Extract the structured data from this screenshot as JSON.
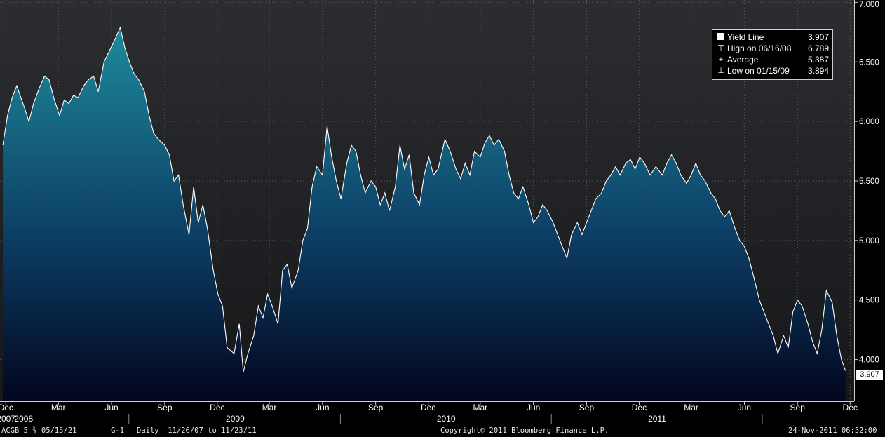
{
  "chart_data": {
    "type": "area",
    "series": [
      {
        "name": "Yield Line",
        "points": [
          [
            "2007-11-26",
            5.8
          ],
          [
            "2007-12-04",
            6.05
          ],
          [
            "2007-12-12",
            6.2
          ],
          [
            "2007-12-20",
            6.3
          ],
          [
            "2008-01-02",
            6.12
          ],
          [
            "2008-01-10",
            6.0
          ],
          [
            "2008-01-18",
            6.15
          ],
          [
            "2008-01-28",
            6.28
          ],
          [
            "2008-02-06",
            6.38
          ],
          [
            "2008-02-14",
            6.35
          ],
          [
            "2008-02-22",
            6.2
          ],
          [
            "2008-03-03",
            6.05
          ],
          [
            "2008-03-11",
            6.18
          ],
          [
            "2008-03-19",
            6.15
          ],
          [
            "2008-03-27",
            6.22
          ],
          [
            "2008-04-04",
            6.2
          ],
          [
            "2008-04-14",
            6.3
          ],
          [
            "2008-04-22",
            6.35
          ],
          [
            "2008-05-01",
            6.38
          ],
          [
            "2008-05-09",
            6.25
          ],
          [
            "2008-05-19",
            6.5
          ],
          [
            "2008-05-29",
            6.6
          ],
          [
            "2008-06-06",
            6.68
          ],
          [
            "2008-06-16",
            6.789
          ],
          [
            "2008-06-24",
            6.62
          ],
          [
            "2008-07-02",
            6.5
          ],
          [
            "2008-07-10",
            6.4
          ],
          [
            "2008-07-18",
            6.35
          ],
          [
            "2008-07-28",
            6.25
          ],
          [
            "2008-08-05",
            6.05
          ],
          [
            "2008-08-13",
            5.9
          ],
          [
            "2008-08-21",
            5.85
          ],
          [
            "2008-09-01",
            5.8
          ],
          [
            "2008-09-09",
            5.72
          ],
          [
            "2008-09-17",
            5.5
          ],
          [
            "2008-09-25",
            5.55
          ],
          [
            "2008-10-03",
            5.3
          ],
          [
            "2008-10-13",
            5.05
          ],
          [
            "2008-10-21",
            5.45
          ],
          [
            "2008-10-29",
            5.15
          ],
          [
            "2008-11-06",
            5.3
          ],
          [
            "2008-11-14",
            5.1
          ],
          [
            "2008-11-24",
            4.75
          ],
          [
            "2008-12-02",
            4.55
          ],
          [
            "2008-12-10",
            4.45
          ],
          [
            "2008-12-18",
            4.1
          ],
          [
            "2008-12-30",
            4.05
          ],
          [
            "2009-01-08",
            4.3
          ],
          [
            "2009-01-15",
            3.894
          ],
          [
            "2009-01-23",
            4.05
          ],
          [
            "2009-02-02",
            4.2
          ],
          [
            "2009-02-10",
            4.45
          ],
          [
            "2009-02-18",
            4.35
          ],
          [
            "2009-02-26",
            4.55
          ],
          [
            "2009-03-06",
            4.45
          ],
          [
            "2009-03-16",
            4.3
          ],
          [
            "2009-03-24",
            4.75
          ],
          [
            "2009-04-01",
            4.8
          ],
          [
            "2009-04-09",
            4.6
          ],
          [
            "2009-04-20",
            4.75
          ],
          [
            "2009-04-28",
            5.0
          ],
          [
            "2009-05-06",
            5.1
          ],
          [
            "2009-05-14",
            5.45
          ],
          [
            "2009-05-22",
            5.62
          ],
          [
            "2009-06-01",
            5.55
          ],
          [
            "2009-06-09",
            5.96
          ],
          [
            "2009-06-17",
            5.7
          ],
          [
            "2009-06-25",
            5.5
          ],
          [
            "2009-07-03",
            5.35
          ],
          [
            "2009-07-13",
            5.65
          ],
          [
            "2009-07-21",
            5.8
          ],
          [
            "2009-07-29",
            5.75
          ],
          [
            "2009-08-06",
            5.55
          ],
          [
            "2009-08-14",
            5.4
          ],
          [
            "2009-08-24",
            5.5
          ],
          [
            "2009-09-01",
            5.45
          ],
          [
            "2009-09-09",
            5.3
          ],
          [
            "2009-09-17",
            5.4
          ],
          [
            "2009-09-25",
            5.25
          ],
          [
            "2009-10-05",
            5.45
          ],
          [
            "2009-10-13",
            5.8
          ],
          [
            "2009-10-21",
            5.6
          ],
          [
            "2009-10-29",
            5.72
          ],
          [
            "2009-11-06",
            5.4
          ],
          [
            "2009-11-16",
            5.3
          ],
          [
            "2009-11-24",
            5.55
          ],
          [
            "2009-12-02",
            5.7
          ],
          [
            "2009-12-10",
            5.55
          ],
          [
            "2009-12-18",
            5.6
          ],
          [
            "2009-12-30",
            5.85
          ],
          [
            "2010-01-08",
            5.75
          ],
          [
            "2010-01-18",
            5.6
          ],
          [
            "2010-01-26",
            5.52
          ],
          [
            "2010-02-03",
            5.65
          ],
          [
            "2010-02-11",
            5.55
          ],
          [
            "2010-02-19",
            5.75
          ],
          [
            "2010-03-01",
            5.7
          ],
          [
            "2010-03-09",
            5.82
          ],
          [
            "2010-03-17",
            5.88
          ],
          [
            "2010-03-25",
            5.8
          ],
          [
            "2010-04-02",
            5.85
          ],
          [
            "2010-04-12",
            5.75
          ],
          [
            "2010-04-20",
            5.55
          ],
          [
            "2010-04-28",
            5.4
          ],
          [
            "2010-05-06",
            5.35
          ],
          [
            "2010-05-14",
            5.45
          ],
          [
            "2010-05-24",
            5.3
          ],
          [
            "2010-06-01",
            5.15
          ],
          [
            "2010-06-09",
            5.2
          ],
          [
            "2010-06-17",
            5.3
          ],
          [
            "2010-06-25",
            5.25
          ],
          [
            "2010-07-05",
            5.15
          ],
          [
            "2010-07-13",
            5.05
          ],
          [
            "2010-07-21",
            4.95
          ],
          [
            "2010-07-29",
            4.85
          ],
          [
            "2010-08-06",
            5.05
          ],
          [
            "2010-08-16",
            5.15
          ],
          [
            "2010-08-24",
            5.05
          ],
          [
            "2010-09-01",
            5.15
          ],
          [
            "2010-09-09",
            5.25
          ],
          [
            "2010-09-17",
            5.35
          ],
          [
            "2010-09-27",
            5.4
          ],
          [
            "2010-10-05",
            5.5
          ],
          [
            "2010-10-13",
            5.55
          ],
          [
            "2010-10-21",
            5.62
          ],
          [
            "2010-10-29",
            5.55
          ],
          [
            "2010-11-08",
            5.65
          ],
          [
            "2010-11-16",
            5.68
          ],
          [
            "2010-11-24",
            5.6
          ],
          [
            "2010-12-02",
            5.7
          ],
          [
            "2010-12-10",
            5.65
          ],
          [
            "2010-12-20",
            5.55
          ],
          [
            "2010-12-30",
            5.62
          ],
          [
            "2011-01-10",
            5.55
          ],
          [
            "2011-01-18",
            5.65
          ],
          [
            "2011-01-26",
            5.72
          ],
          [
            "2011-02-03",
            5.65
          ],
          [
            "2011-02-11",
            5.55
          ],
          [
            "2011-02-21",
            5.48
          ],
          [
            "2011-03-01",
            5.55
          ],
          [
            "2011-03-09",
            5.65
          ],
          [
            "2011-03-17",
            5.55
          ],
          [
            "2011-03-25",
            5.5
          ],
          [
            "2011-04-04",
            5.4
          ],
          [
            "2011-04-12",
            5.35
          ],
          [
            "2011-04-20",
            5.25
          ],
          [
            "2011-04-28",
            5.2
          ],
          [
            "2011-05-06",
            5.25
          ],
          [
            "2011-05-16",
            5.1
          ],
          [
            "2011-05-24",
            5.0
          ],
          [
            "2011-06-01",
            4.95
          ],
          [
            "2011-06-09",
            4.85
          ],
          [
            "2011-06-17",
            4.7
          ],
          [
            "2011-06-27",
            4.5
          ],
          [
            "2011-07-05",
            4.4
          ],
          [
            "2011-07-13",
            4.3
          ],
          [
            "2011-07-21",
            4.2
          ],
          [
            "2011-07-29",
            4.05
          ],
          [
            "2011-08-08",
            4.2
          ],
          [
            "2011-08-16",
            4.1
          ],
          [
            "2011-08-24",
            4.4
          ],
          [
            "2011-09-01",
            4.5
          ],
          [
            "2011-09-09",
            4.45
          ],
          [
            "2011-09-19",
            4.3
          ],
          [
            "2011-09-27",
            4.15
          ],
          [
            "2011-10-05",
            4.05
          ],
          [
            "2011-10-13",
            4.25
          ],
          [
            "2011-10-21",
            4.58
          ],
          [
            "2011-10-31",
            4.48
          ],
          [
            "2011-11-08",
            4.2
          ],
          [
            "2011-11-16",
            4.0
          ],
          [
            "2011-11-23",
            3.907
          ]
        ]
      }
    ],
    "y_ticks": [
      "4.000",
      "4.500",
      "5.000",
      "5.500",
      "6.000",
      "6.500",
      "7.000"
    ],
    "ylim": [
      3.65,
      7.02
    ],
    "x_range": [
      "2007-11-21",
      "2011-12-08"
    ],
    "x_month_ticks": [
      {
        "date": "2007-12-01",
        "label": "Dec"
      },
      {
        "date": "2008-03-01",
        "label": "Mar"
      },
      {
        "date": "2008-06-01",
        "label": "Jun"
      },
      {
        "date": "2008-09-01",
        "label": "Sep"
      },
      {
        "date": "2008-12-01",
        "label": "Dec"
      },
      {
        "date": "2009-03-01",
        "label": "Mar"
      },
      {
        "date": "2009-06-01",
        "label": "Jun"
      },
      {
        "date": "2009-09-01",
        "label": "Sep"
      },
      {
        "date": "2009-12-01",
        "label": "Dec"
      },
      {
        "date": "2010-03-01",
        "label": "Mar"
      },
      {
        "date": "2010-06-01",
        "label": "Jun"
      },
      {
        "date": "2010-09-01",
        "label": "Sep"
      },
      {
        "date": "2010-12-01",
        "label": "Dec"
      },
      {
        "date": "2011-03-01",
        "label": "Mar"
      },
      {
        "date": "2011-06-01",
        "label": "Jun"
      },
      {
        "date": "2011-09-01",
        "label": "Sep"
      },
      {
        "date": "2011-12-01",
        "label": "Dec"
      }
    ],
    "x_year_ticks": [
      {
        "date": "2007-01-01",
        "label": "2007"
      },
      {
        "date": "2008-01-01",
        "label": "2008"
      },
      {
        "date": "2009-01-01",
        "label": "2009"
      },
      {
        "date": "2010-01-01",
        "label": "2010"
      },
      {
        "date": "2011-01-01",
        "label": "2011"
      }
    ],
    "grid": true,
    "legend_position": "top-right",
    "last_value": "3.907"
  },
  "legend": {
    "rows": [
      {
        "symbol": "box",
        "label": "Yield Line",
        "value": "3.907"
      },
      {
        "symbol": "⊤",
        "label": "High on 06/16/08",
        "value": "6.789"
      },
      {
        "symbol": "+",
        "label": "Average",
        "value": "5.387"
      },
      {
        "symbol": "⊥",
        "label": "Low on 01/15/09",
        "value": "3.894"
      }
    ]
  },
  "footer": {
    "security": "ACGB 5 ¾ 05/15/21",
    "source": "G-1",
    "period": "Daily  11/26/07 to 11/23/11",
    "copyright": "Copyright© 2011 Bloomberg Finance L.P.",
    "timestamp": "24-Nov-2011 06:52:00"
  },
  "colors": {
    "area_top": "#1e8a9a",
    "area_mid": "#0d3f66",
    "area_bottom": "#02061e",
    "line": "#ffffff",
    "background_top": "#2b2d30",
    "background_bottom": "#151719"
  }
}
